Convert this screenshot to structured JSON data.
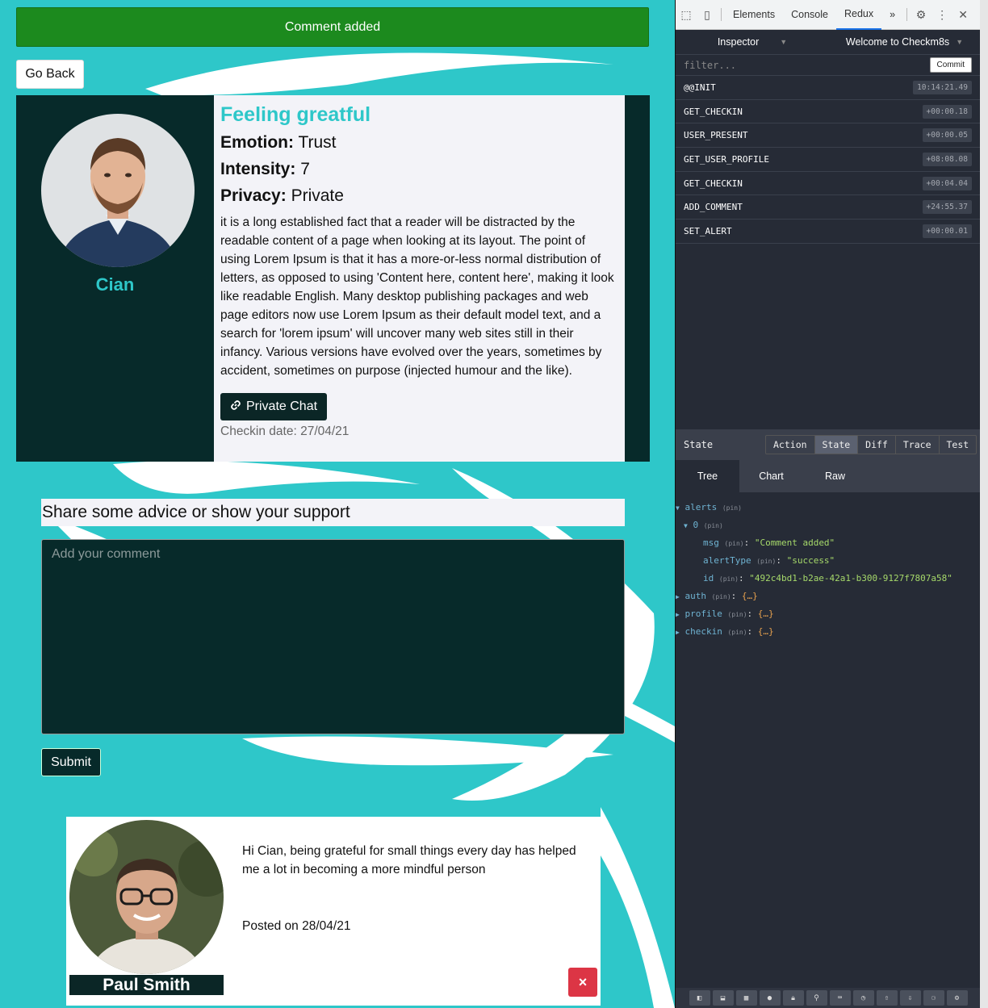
{
  "alert": {
    "message": "Comment added"
  },
  "go_back_label": "Go Back",
  "checkin": {
    "user_name": "Cian",
    "title": "Feeling greatful",
    "emotion_label": "Emotion:",
    "emotion_value": "Trust",
    "intensity_label": "Intensity:",
    "intensity_value": "7",
    "privacy_label": "Privacy:",
    "privacy_value": "Private",
    "text": "it is a long established fact that a reader will be distracted by the readable content of a page when looking at its layout. The point of using Lorem Ipsum is that it has a more-or-less normal distribution of letters, as opposed to using 'Content here, content here', making it look like readable English. Many desktop publishing packages and web page editors now use Lorem Ipsum as their default model text, and a search for 'lorem ipsum' will uncover many web sites still in their infancy. Various versions have evolved over the years, sometimes by accident, sometimes on purpose (injected humour and the like).",
    "private_chat_label": "Private Chat",
    "checkin_date": "Checkin date: 27/04/21"
  },
  "advice_heading": "Share some advice or show your support",
  "comment_form": {
    "placeholder": "Add your comment",
    "submit_label": "Submit"
  },
  "comment": {
    "author": "Paul Smith",
    "text": "Hi Cian, being grateful for small things every day has helped me a lot in becoming a more mindful person",
    "posted": "Posted on 28/04/21",
    "delete_icon": "×"
  },
  "devtools": {
    "tabs": [
      "Elements",
      "Console",
      "Redux",
      "»"
    ],
    "active_tab": "Redux",
    "inspector_label": "Inspector",
    "instance_label": "Welcome to Checkm8s",
    "filter_placeholder": "filter...",
    "commit_label": "Commit",
    "actions": [
      {
        "name": "@@INIT",
        "time": "10:14:21.49"
      },
      {
        "name": "GET_CHECKIN",
        "time": "+00:00.18"
      },
      {
        "name": "USER_PRESENT",
        "time": "+00:00.05"
      },
      {
        "name": "GET_USER_PROFILE",
        "time": "+08:08.08"
      },
      {
        "name": "GET_CHECKIN",
        "time": "+00:04.04"
      },
      {
        "name": "ADD_COMMENT",
        "time": "+24:55.37"
      },
      {
        "name": "SET_ALERT",
        "time": "+00:00.01"
      }
    ],
    "state_label": "State",
    "segments": [
      "Action",
      "State",
      "Diff",
      "Trace",
      "Test"
    ],
    "active_segment": "State",
    "sub_tabs": [
      "Tree",
      "Chart",
      "Raw"
    ],
    "active_sub_tab": "Tree",
    "tree": {
      "pin": "(pin)",
      "alerts_key": "alerts",
      "index_key": "0",
      "msg_key": "msg",
      "msg_value": "\"Comment added\"",
      "alert_type_key": "alertType",
      "alert_type_value": "\"success\"",
      "id_key": "id",
      "id_value": "\"492c4bd1-b2ae-42a1-b300-9127f7807a58\"",
      "auth_key": "auth",
      "profile_key": "profile",
      "checkin_key": "checkin",
      "collapsed": "{…}"
    }
  },
  "colors": {
    "teal": "#2ec7c9",
    "dark": "#072a2a",
    "alert_green": "#1c8a1e",
    "danger": "#dc3545"
  }
}
